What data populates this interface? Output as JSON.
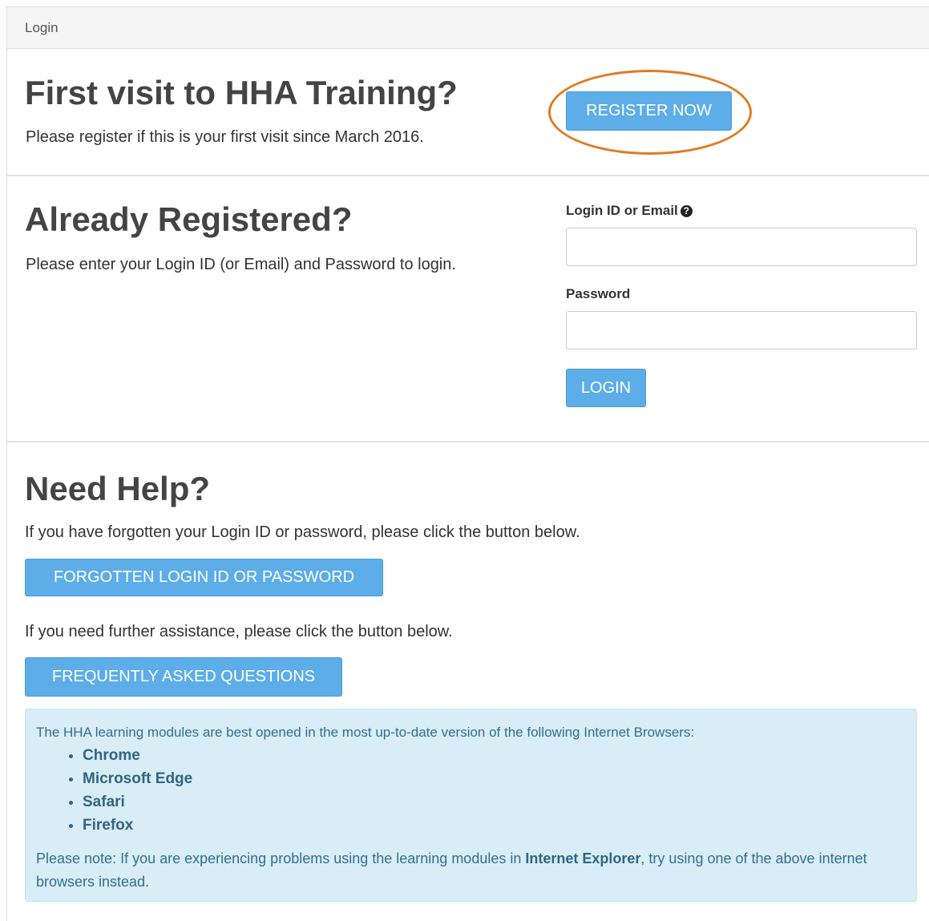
{
  "header": {
    "title": "Login"
  },
  "register_section": {
    "heading": "First visit to HHA Training?",
    "description": "Please register if this is your first visit since March 2016.",
    "register_button": "REGISTER NOW",
    "highlight_color": "#e07b24"
  },
  "login_section": {
    "heading": "Already Registered?",
    "description": "Please enter your Login ID (or Email) and Password to login.",
    "login_id_label": "Login ID or Email",
    "login_id_value": "",
    "password_label": "Password",
    "password_value": "",
    "login_button": "LOGIN",
    "help_icon": "question-circle-icon"
  },
  "help_section": {
    "heading": "Need Help?",
    "forgot_text": "If you have forgotten your Login ID or password, please click the button below.",
    "forgot_button": "FORGOTTEN LOGIN ID OR PASSWORD",
    "assist_text": "If you need further assistance, please click the button below.",
    "faq_button": "FREQUENTLY ASKED QUESTIONS"
  },
  "browser_notice": {
    "intro": "The HHA learning modules are best opened in the most up-to-date version of the following Internet Browsers:",
    "browsers": [
      "Chrome",
      "Microsoft Edge",
      "Safari",
      "Firefox"
    ],
    "note_prefix": "Please note: If you are experiencing problems using the learning modules in ",
    "note_bold": "Internet Explorer",
    "note_suffix": ", try using one of the above internet browsers instead."
  },
  "colors": {
    "button": "#5dade8",
    "alert_background": "#d9edf7",
    "alert_text": "#31708f"
  }
}
